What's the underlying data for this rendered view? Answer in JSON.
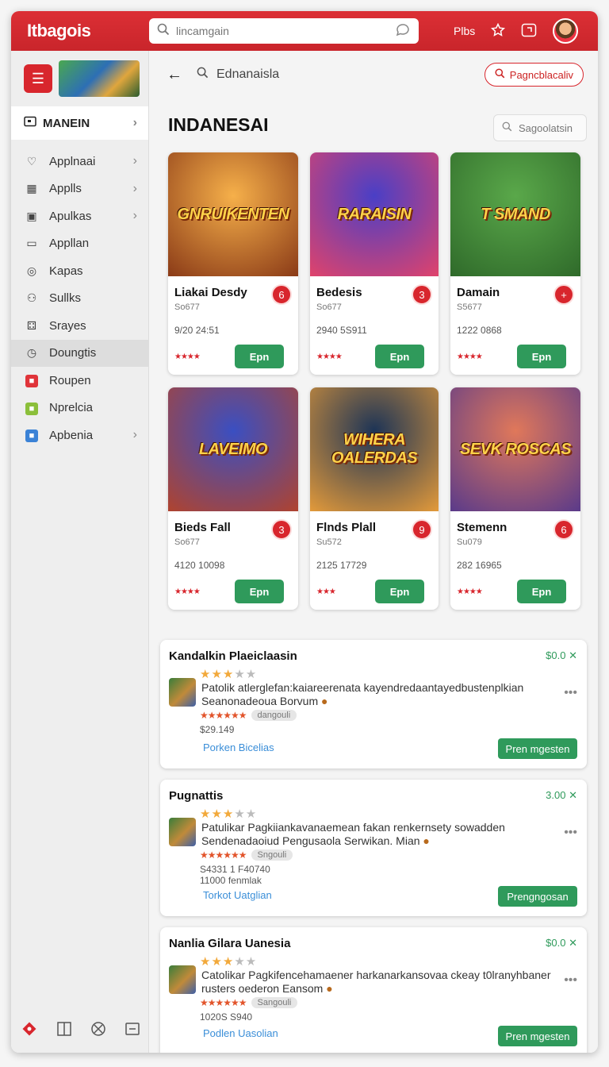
{
  "app": {
    "brand": "Itbagois"
  },
  "search": {
    "placeholder": "lincamgain"
  },
  "topbar": {
    "right_label": "Plbs"
  },
  "sidebar": {
    "active_label": "MANEIN",
    "items": [
      {
        "label": "Applnaai",
        "icon": "heart-icon",
        "chevron": true
      },
      {
        "label": "Applls",
        "icon": "apps-icon",
        "chevron": true
      },
      {
        "label": "Apulkas",
        "icon": "square-icon",
        "chevron": true
      },
      {
        "label": "Appllan",
        "icon": "box-icon",
        "chevron": false
      },
      {
        "label": "Kapas",
        "icon": "target-icon",
        "chevron": false
      },
      {
        "label": "Sullks",
        "icon": "user-icon",
        "chevron": false
      },
      {
        "label": "Srayes",
        "icon": "dice-icon",
        "chevron": false
      },
      {
        "label": "Doungtis",
        "icon": "clock-icon",
        "chevron": false,
        "selected": true
      },
      {
        "label": "Roupen",
        "icon": "red-app-icon",
        "chevron": false
      },
      {
        "label": "Nprelcia",
        "icon": "green-app-icon",
        "chevron": false
      },
      {
        "label": "Apbenia",
        "icon": "blue-app-icon",
        "chevron": true
      }
    ]
  },
  "main": {
    "crumb": "Ednanaisla",
    "action_button": "Pagncblacaliv",
    "section_title": "INDANESAI",
    "suggest_label": "Sagoolatsin"
  },
  "cards": [
    {
      "art": "GNRUIKENTEN",
      "name": "Liakai Desdy",
      "sub": "So677",
      "meta": "9/20 24:51",
      "badge": "6",
      "stars": "★★★★",
      "button": "Epn",
      "colors": [
        "#f6b04a",
        "#8a3a17"
      ]
    },
    {
      "art": "RARAISIN",
      "name": "Bedesis",
      "sub": "So677",
      "meta": "2940 5S911",
      "badge": "3",
      "stars": "★★★★",
      "button": "Epn",
      "colors": [
        "#4a3fc6",
        "#e0436b"
      ]
    },
    {
      "art": "T SMAND",
      "name": "Damain",
      "sub": "S5677",
      "meta": "1222 0868",
      "badge": "+",
      "stars": "★★★★",
      "button": "Epn",
      "colors": [
        "#5aa84a",
        "#2f6a2a"
      ]
    },
    {
      "art": "LAVEIMO",
      "name": "Bieds Fall",
      "sub": "So677",
      "meta": "4120 10098",
      "badge": "3",
      "stars": "★★★★",
      "button": "Epn",
      "colors": [
        "#3a4fc2",
        "#b0432e"
      ]
    },
    {
      "art": "WIHERA OALERDAS",
      "name": "Flnds Plall",
      "sub": "Su572",
      "meta": "2125 17729",
      "badge": "9",
      "stars": "★★★",
      "button": "Epn",
      "colors": [
        "#1d3456",
        "#e39a3a"
      ]
    },
    {
      "art": "SEVK ROSCAS",
      "name": "Stemenn",
      "sub": "Su079",
      "meta": "282 16965",
      "badge": "6",
      "stars": "★★★★",
      "button": "Epn",
      "colors": [
        "#e0785a",
        "#5a3a8a"
      ]
    }
  ],
  "list": [
    {
      "title": "Kandalkin Plaeiclaasin",
      "price": "$0.0",
      "rating": 3,
      "desc1": "Patolik atlerglefan:kaiareerenata kayendredaantayedbustenplkian",
      "desc2": "Seanonadeoua Borvum",
      "chip": "dangouli",
      "num1": "$29.149",
      "num2": "",
      "link": "Porken Bicelias",
      "button": "Pren mgesten"
    },
    {
      "title": "Pugnattis",
      "price": "3.00",
      "rating": 3,
      "desc1": "Patulikar Pagkiiankavanaemean fakan renkernsety sowadden",
      "desc2": "Sendenadaoiud Pengusaola Serwikan. Mian",
      "chip": "Sngouli",
      "num1": "S4331 1 F40740",
      "num2": "11000 fenmlak",
      "link": "Torkot Uatglian",
      "button": "Prengngosan"
    },
    {
      "title": "Nanlia Gilara Uanesia",
      "price": "$0.0",
      "rating": 3,
      "desc1": "Catolikar Pagkifencehamaener harkanarkansovaa ckeay t0lranyhbaner",
      "desc2": "rusters oederon Eansom",
      "chip": "Sangouli",
      "num1": "1020S S940",
      "num2": "",
      "link": "Podlen Uasolian",
      "button": "Pren mgesten"
    }
  ]
}
